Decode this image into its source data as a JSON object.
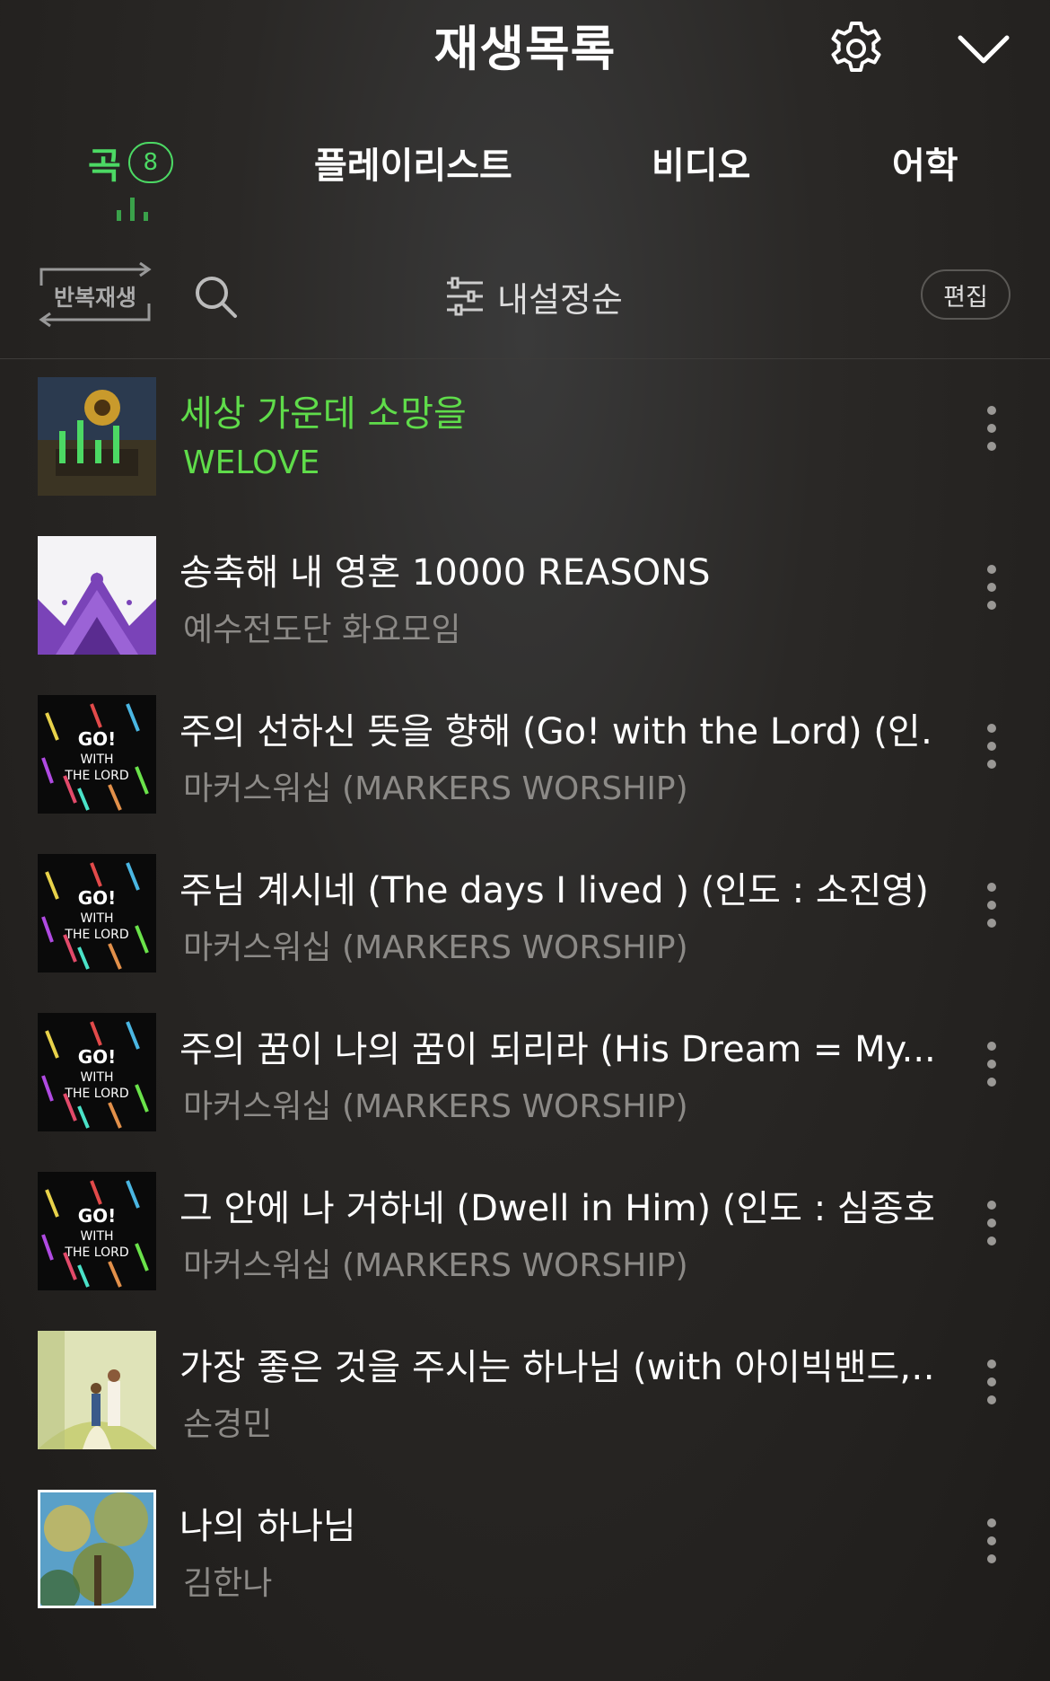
{
  "header": {
    "title": "재생목록",
    "icons": {
      "settings": "gear-icon",
      "collapse": "chevron-down-icon"
    }
  },
  "tabs": [
    {
      "label": "곡",
      "count": "8",
      "active": true
    },
    {
      "label": "플레이리스트"
    },
    {
      "label": "비디오"
    },
    {
      "label": "어학"
    }
  ],
  "toolbar": {
    "repeat_label": "반복재생",
    "sort_label": "내설정순",
    "edit_label": "편집"
  },
  "songs": [
    {
      "title": "세상 가운데 소망을",
      "artist": "WELOVE",
      "playing": true,
      "art": "sunflower"
    },
    {
      "title": "송축해 내 영혼 10000 REASONS",
      "artist": "예수전도단 화요모임",
      "art": "crown"
    },
    {
      "title": "주의 선하신 뜻을 향해 (Go! with the Lord) (인…",
      "artist": "마커스워십 (MARKERS WORSHIP)",
      "art": "markers"
    },
    {
      "title": "주님 계시네 (The days I lived ) (인도 : 소진영)",
      "artist": "마커스워십 (MARKERS WORSHIP)",
      "art": "markers"
    },
    {
      "title": "주의 꿈이 나의 꿈이 되리라 (His Dream = My...",
      "artist": "마커스워십 (MARKERS WORSHIP)",
      "art": "markers"
    },
    {
      "title": "그 안에 나 거하네 (Dwell in Him) (인도 : 심종호)",
      "artist": "마커스워십 (MARKERS WORSHIP)",
      "art": "markers"
    },
    {
      "title": "가장 좋은 것을 주시는 하나님 (with 아이빅밴드,…",
      "artist": "손경민",
      "art": "painting"
    },
    {
      "title": "나의 하나님",
      "artist": "김한나",
      "art": "tree"
    }
  ],
  "colors": {
    "accent": "#4cd964",
    "background": "#262422",
    "muted_text": "#8c8a87"
  }
}
